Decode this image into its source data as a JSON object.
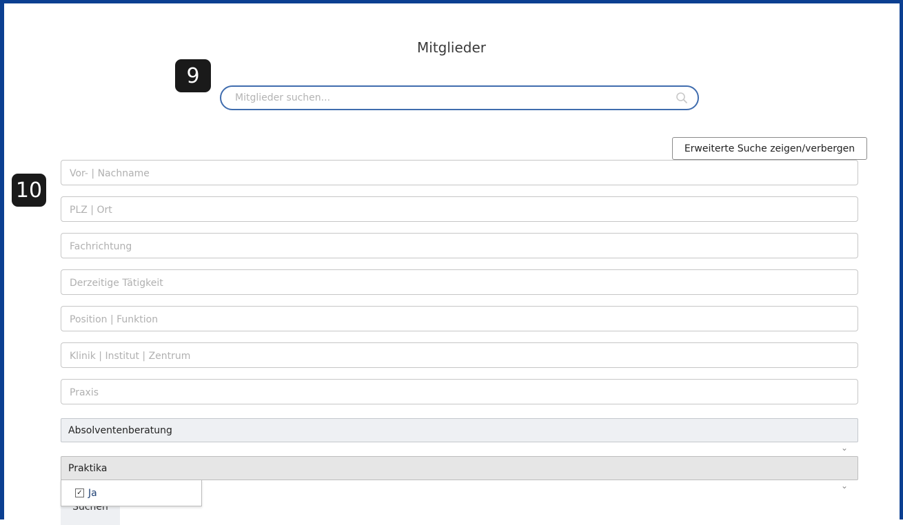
{
  "page": {
    "title": "Mitglieder"
  },
  "badges": {
    "step9": "9",
    "step10": "10"
  },
  "search": {
    "placeholder": "Mitglieder suchen...",
    "icon": "search-icon"
  },
  "advanced_toggle": {
    "label": "Erweiterte Suche zeigen/verbergen"
  },
  "fields": [
    {
      "placeholder": "Vor- | Nachname"
    },
    {
      "placeholder": "PLZ | Ort"
    },
    {
      "placeholder": "Fachrichtung"
    },
    {
      "placeholder": "Derzeitige Tätigkeit"
    },
    {
      "placeholder": "Position | Funktion"
    },
    {
      "placeholder": "Klinik | Institut | Zentrum"
    },
    {
      "placeholder": "Praxis"
    }
  ],
  "selects": {
    "absolventenberatung": {
      "label": "Absolventenberatung"
    },
    "praktika": {
      "label": "Praktika",
      "options": [
        {
          "label": "Ja",
          "checked": true
        }
      ]
    }
  },
  "submit": {
    "label": "Suchen"
  },
  "colors": {
    "frame": "#0b3f91",
    "search_border": "#3f6cae",
    "option_text": "#1d3f73"
  }
}
